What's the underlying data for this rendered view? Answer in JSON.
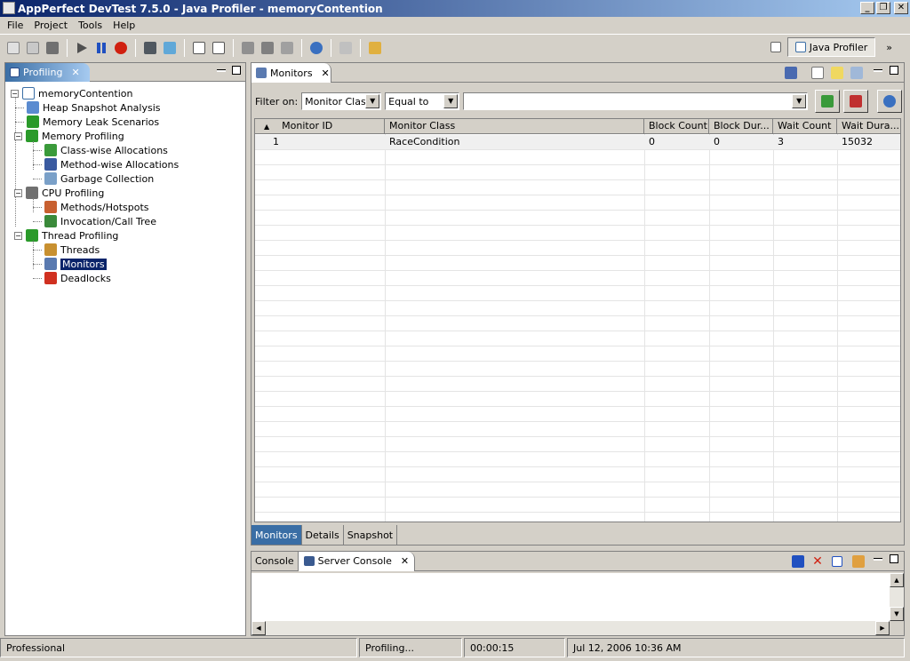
{
  "window": {
    "title": "AppPerfect DevTest 7.5.0 - Java Profiler - memoryContention",
    "minimize": "_",
    "restore": "❐",
    "close": "✕"
  },
  "menu": {
    "items": [
      {
        "label": "File"
      },
      {
        "label": "Project"
      },
      {
        "label": "Tools"
      },
      {
        "label": "Help"
      }
    ]
  },
  "toolbar": {
    "icons": [
      "new-icon",
      "open-icon",
      "save-icon",
      "run-icon",
      "pause-icon",
      "stop-icon",
      "camera-icon",
      "refresh-icon",
      "edit-icon",
      "check-icon",
      "export-icon",
      "plugin-icon",
      "task-icon",
      "help-icon",
      "back-icon",
      "wand-icon"
    ]
  },
  "perspective": {
    "label": "Java Profiler",
    "overflow": "»"
  },
  "profiling_view": {
    "tab_label": "Profiling",
    "tree": {
      "root": "memoryContention",
      "items": [
        {
          "label": "Heap Snapshot Analysis",
          "level": 1,
          "icon": "heap-snapshot-icon",
          "color": "#5b8bd0"
        },
        {
          "label": "Memory Leak Scenarios",
          "level": 1,
          "icon": "memory-leak-icon",
          "color": "#2a9a2a"
        },
        {
          "label": "Memory Profiling",
          "level": 1,
          "icon": "memory-profiling-icon",
          "color": "#2a9a2a",
          "expander": "−"
        },
        {
          "label": "Class-wise Allocations",
          "level": 2,
          "icon": "class-alloc-icon",
          "color": "#3a9a3a"
        },
        {
          "label": "Method-wise Allocations",
          "level": 2,
          "icon": "method-alloc-icon",
          "color": "#3a5aa0"
        },
        {
          "label": "Garbage Collection",
          "level": 2,
          "icon": "garbage-collection-icon",
          "color": "#7aa0c8"
        },
        {
          "label": "CPU Profiling",
          "level": 1,
          "icon": "cpu-profiling-icon",
          "color": "#707070",
          "expander": "−"
        },
        {
          "label": "Methods/Hotspots",
          "level": 2,
          "icon": "hotspots-icon",
          "color": "#c86030"
        },
        {
          "label": "Invocation/Call Tree",
          "level": 2,
          "icon": "call-tree-icon",
          "color": "#3a8a3a"
        },
        {
          "label": "Thread Profiling",
          "level": 1,
          "icon": "thread-profiling-icon",
          "color": "#2a9a2a",
          "expander": "−"
        },
        {
          "label": "Threads",
          "level": 2,
          "icon": "threads-icon",
          "color": "#c89030"
        },
        {
          "label": "Monitors",
          "level": 2,
          "icon": "monitors-icon",
          "color": "#5a7ab0",
          "selected": true
        },
        {
          "label": "Deadlocks",
          "level": 2,
          "icon": "deadlocks-icon",
          "color": "#d03020"
        }
      ]
    }
  },
  "monitors_view": {
    "tab_label": "Monitors",
    "filter": {
      "label": "Filter on:",
      "field": "Monitor Class",
      "operator": "Equal to",
      "value": ""
    },
    "columns": [
      "Monitor ID",
      "Monitor Class",
      "Block Count",
      "Block Dur...",
      "Wait Count",
      "Wait Dura..."
    ],
    "rows": [
      [
        "1",
        "RaceCondition",
        "0",
        "0",
        "3",
        "15032"
      ]
    ],
    "sort_indicator": "▲",
    "bottom_tabs": [
      "Monitors",
      "Details",
      "Snapshot"
    ]
  },
  "console_view": {
    "tabs": [
      "Console",
      "Server Console"
    ]
  },
  "status": {
    "edition": "Professional",
    "state": "Profiling...",
    "elapsed": "00:00:15",
    "datetime": "Jul 12, 2006 10:36 AM"
  }
}
